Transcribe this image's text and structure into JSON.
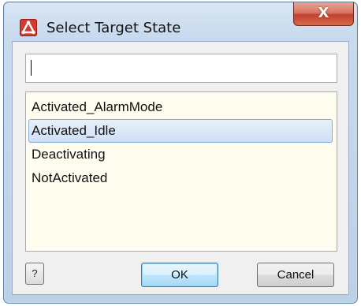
{
  "window": {
    "title": "Select Target State",
    "close_glyph": "X",
    "app_icon": "application-logo-icon"
  },
  "search": {
    "value": "",
    "placeholder": ""
  },
  "list": {
    "items": [
      {
        "label": "Activated_AlarmMode",
        "selected": false
      },
      {
        "label": "Activated_Idle",
        "selected": true
      },
      {
        "label": "Deactivating",
        "selected": false
      },
      {
        "label": "NotActivated",
        "selected": false
      }
    ]
  },
  "buttons": {
    "help_label": "?",
    "ok_label": "OK",
    "cancel_label": "Cancel"
  },
  "colors": {
    "close_button": "#c4412d",
    "list_background": "#fffdf0",
    "selection": "#cfe0f4",
    "app_icon": "#d33b2e"
  }
}
